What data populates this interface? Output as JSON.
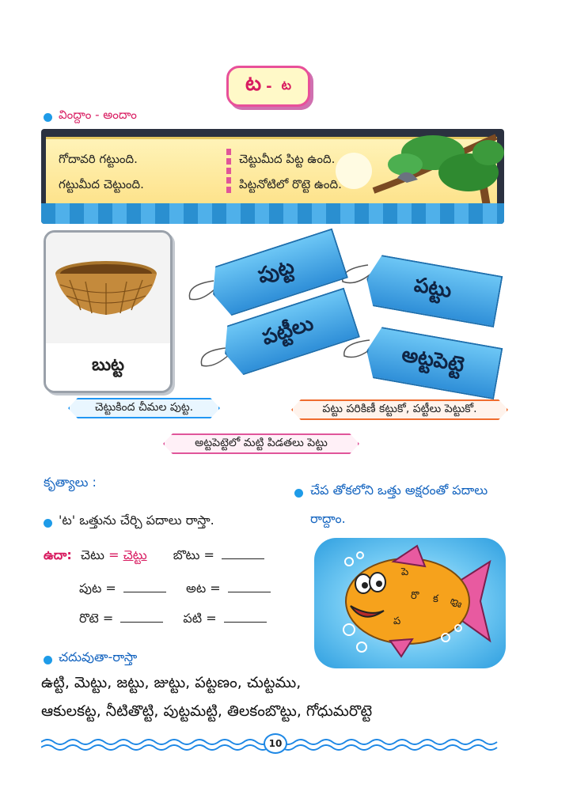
{
  "title": {
    "letter": "ట",
    "separator": "-",
    "variant": "ట"
  },
  "section_listen": "వింద్దాం - అందాం",
  "poem": {
    "left_line1": "గోదావరి గట్టుంది.",
    "left_line2": "గట్టుమీద చెట్టుంది.",
    "right_line1": "చెట్టుమీద పిట్ట ఉంది.",
    "right_line2": "పిట్టనోటిలో రొట్టె ఉంది."
  },
  "basket_label": "బుట్ట",
  "tags": [
    "పుట్ట",
    "పట్టు",
    "పట్టీలు",
    "అట్టపెట్టె"
  ],
  "captions": {
    "left": "చెట్టుకింద చీమల పుట్ట.",
    "right": "పట్టు పరికిణీ కట్టుకో, పట్టీలు పెట్టుకో.",
    "center": "అట్టపెట్టెలో మట్టి పిడతలు పెట్టు"
  },
  "tasks": {
    "heading": "కృత్యాలు :",
    "instruction": "'ట' ఒత్తును చేర్చి పదాలు రాస్తా.",
    "example_label": "ఉదా:",
    "row1": {
      "a": "చెటు",
      "eq": "=",
      "b": "చెట్టు",
      "c": "బొటు",
      "eq2": "="
    },
    "row2": {
      "a": "పుట",
      "eq": "=",
      "c": "అట",
      "eq2": "="
    },
    "row3": {
      "a": "రొటె",
      "eq": "=",
      "c": "పటి",
      "eq2": "="
    }
  },
  "fish_task": {
    "line1": "చేప తోకలోని ఒత్తు అక్షరంతో పదాలు",
    "line2": "రాద్దాం.",
    "letters": [
      "పె",
      "రొ",
      "క",
      "ప",
      "ట్టె"
    ]
  },
  "reading": {
    "heading": "చదువుతా-రాస్తా",
    "line1": "ఉట్టి, మెట్టు, జట్టు, జుట్టు, పట్టణం, చుట్టము,",
    "line2": "ఆకులకట్ట, నీటితొట్టి, పుట్టమట్టి, తిలకంబొట్టు, గోధుమరొట్టె"
  },
  "page_number": "10",
  "colors": {
    "accent_pink": "#d81b60",
    "accent_blue": "#1e9be8",
    "tag_blue": "#2f8fd8"
  }
}
